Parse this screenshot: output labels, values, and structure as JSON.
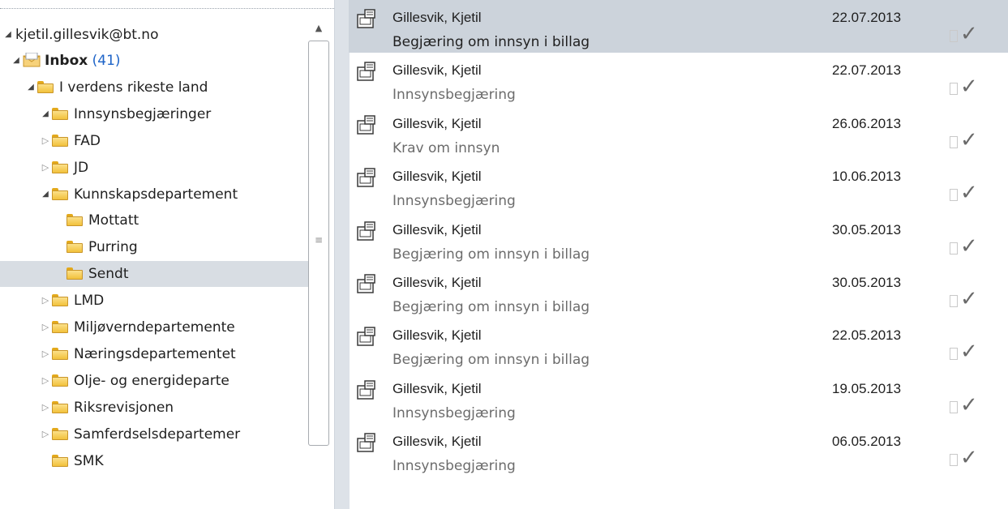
{
  "folder_tree": {
    "account": "kjetil.gillesvik@bt.no",
    "items": [
      {
        "label": "Inbox",
        "count": "(41)",
        "bold": true,
        "expander": "expanded",
        "icon": "inbox-icon"
      },
      {
        "label": "I verdens rikeste land",
        "expander": "expanded",
        "icon": "folder-icon"
      },
      {
        "label": "Innsynsbegjæringer",
        "expander": "expanded",
        "icon": "folder-icon"
      },
      {
        "label": "FAD",
        "expander": "collapsed",
        "icon": "folder-icon"
      },
      {
        "label": "JD",
        "expander": "collapsed",
        "icon": "folder-icon"
      },
      {
        "label": "Kunnskapsdepartement",
        "expander": "expanded",
        "icon": "folder-icon"
      },
      {
        "label": "Mottatt",
        "expander": "none",
        "icon": "folder-icon"
      },
      {
        "label": "Purring",
        "expander": "none",
        "icon": "folder-icon"
      },
      {
        "label": "Sendt",
        "expander": "none",
        "icon": "folder-icon",
        "selected": true
      },
      {
        "label": "LMD",
        "expander": "collapsed",
        "icon": "folder-icon"
      },
      {
        "label": "Miljøverndepartemente",
        "expander": "collapsed",
        "icon": "folder-icon"
      },
      {
        "label": "Næringsdepartementet",
        "expander": "collapsed",
        "icon": "folder-icon"
      },
      {
        "label": "Olje- og energideparte",
        "expander": "collapsed",
        "icon": "folder-icon"
      },
      {
        "label": "Riksrevisjonen",
        "expander": "collapsed",
        "icon": "folder-icon"
      },
      {
        "label": "Samferdselsdepartemer",
        "expander": "collapsed",
        "icon": "folder-icon"
      },
      {
        "label": "SMK",
        "expander": "none",
        "icon": "folder-icon"
      }
    ]
  },
  "messages": [
    {
      "sender": "Gillesvik, Kjetil",
      "subject": "Begjæring om innsyn i billag",
      "date": "22.07.2013",
      "selected": true
    },
    {
      "sender": "Gillesvik, Kjetil",
      "subject": "Innsynsbegjæring",
      "date": "22.07.2013"
    },
    {
      "sender": "Gillesvik, Kjetil",
      "subject": "Krav om innsyn",
      "date": "26.06.2013"
    },
    {
      "sender": "Gillesvik, Kjetil",
      "subject": "Innsynsbegjæring",
      "date": "10.06.2013"
    },
    {
      "sender": "Gillesvik, Kjetil",
      "subject": "Begjæring om innsyn i billag",
      "date": "30.05.2013"
    },
    {
      "sender": "Gillesvik, Kjetil",
      "subject": "Begjæring om innsyn i billag",
      "date": "30.05.2013"
    },
    {
      "sender": "Gillesvik, Kjetil",
      "subject": "Begjæring om innsyn i billag",
      "date": "22.05.2013"
    },
    {
      "sender": "Gillesvik, Kjetil",
      "subject": "Innsynsbegjæring",
      "date": "19.05.2013"
    },
    {
      "sender": "Gillesvik, Kjetil",
      "subject": "Innsynsbegjæring",
      "date": "06.05.2013"
    }
  ],
  "colors": {
    "selected_folder": "#d8dde3",
    "selected_message": "#ccd3db",
    "unread_count": "#1e64c8",
    "divider": "#dde2e8"
  },
  "icons": {
    "message": "sent-message-icon",
    "complete": "check-icon",
    "flag": "flag-box-icon"
  }
}
